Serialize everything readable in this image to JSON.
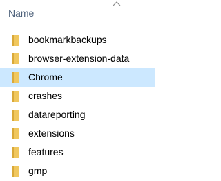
{
  "header": {
    "name_column": "Name",
    "sort_icon": "chevron-up-icon"
  },
  "colors": {
    "selected_row": "#cce8ff",
    "folder_body": "#f0c75e",
    "folder_dark": "#d9a93a",
    "header_text": "#4c607a"
  },
  "files": {
    "items": [
      {
        "label": "bookmarkbackups",
        "icon": "folder-icon",
        "selected": false
      },
      {
        "label": "browser-extension-data",
        "icon": "folder-icon",
        "selected": false
      },
      {
        "label": "Chrome",
        "icon": "folder-icon",
        "selected": true
      },
      {
        "label": "crashes",
        "icon": "folder-icon",
        "selected": false
      },
      {
        "label": "datareporting",
        "icon": "folder-icon",
        "selected": false
      },
      {
        "label": "extensions",
        "icon": "folder-icon",
        "selected": false
      },
      {
        "label": "features",
        "icon": "folder-icon",
        "selected": false
      },
      {
        "label": "gmp",
        "icon": "folder-icon",
        "selected": false
      }
    ]
  }
}
